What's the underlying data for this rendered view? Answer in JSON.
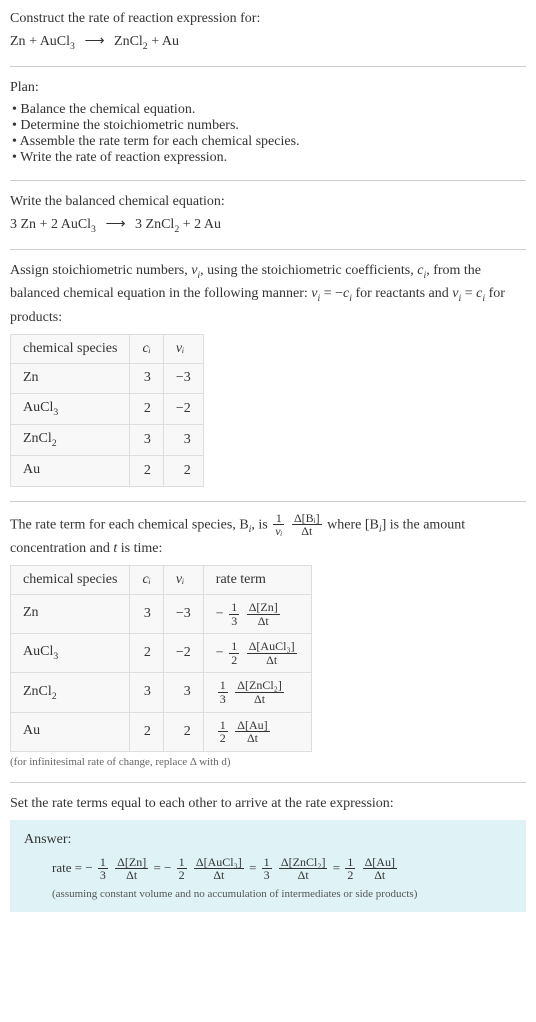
{
  "header": {
    "title": "Construct the rate of reaction expression for:",
    "reaction_lhs1": "Zn",
    "reaction_lhs2": "AuCl",
    "reaction_lhs2_sub": "3",
    "arrow": "⟶",
    "reaction_rhs1": "ZnCl",
    "reaction_rhs1_sub": "2",
    "reaction_rhs2": "Au"
  },
  "plan": {
    "title": "Plan:",
    "items": [
      "Balance the chemical equation.",
      "Determine the stoichiometric numbers.",
      "Assemble the rate term for each chemical species.",
      "Write the rate of reaction expression."
    ]
  },
  "balanced": {
    "title": "Write the balanced chemical equation:",
    "c1": "3",
    "s1": "Zn",
    "c2": "2",
    "s2": "AuCl",
    "s2sub": "3",
    "arrow": "⟶",
    "c3": "3",
    "s3": "ZnCl",
    "s3sub": "2",
    "c4": "2",
    "s4": "Au"
  },
  "stoich": {
    "para1a": "Assign stoichiometric numbers, ",
    "nu_i": "ν",
    "isub": "i",
    "para1b": ", using the stoichiometric coefficients, ",
    "c_i": "c",
    "para1c": ", from the balanced chemical equation in the following manner: ",
    "rel_react": " = −",
    "for_react": " for reactants and ",
    "rel_prod": " = ",
    "for_prod": " for products:",
    "th1": "chemical species",
    "th2": "cᵢ",
    "th3": "νᵢ",
    "rows": [
      {
        "name": "Zn",
        "sub": "",
        "c": "3",
        "nu": "−3"
      },
      {
        "name": "AuCl",
        "sub": "3",
        "c": "2",
        "nu": "−2"
      },
      {
        "name": "ZnCl",
        "sub": "2",
        "c": "3",
        "nu": "3"
      },
      {
        "name": "Au",
        "sub": "",
        "c": "2",
        "nu": "2"
      }
    ]
  },
  "rateterm": {
    "para_a": "The rate term for each chemical species, B",
    "para_b": ", is ",
    "one": "1",
    "nu_i": "νᵢ",
    "dB": "Δ[Bᵢ]",
    "dt": "Δt",
    "para_c": " where [B",
    "para_d": "] is the amount concentration and ",
    "t": "t",
    "para_e": " is time:",
    "th1": "chemical species",
    "th2": "cᵢ",
    "th3": "νᵢ",
    "th4": "rate term",
    "rows": [
      {
        "name": "Zn",
        "sub": "",
        "c": "3",
        "nu": "−3",
        "sign": "− ",
        "fn": "1",
        "fd": "3",
        "dn": "Δ[Zn]",
        "dd": "Δt"
      },
      {
        "name": "AuCl",
        "sub": "3",
        "c": "2",
        "nu": "−2",
        "sign": "− ",
        "fn": "1",
        "fd": "2",
        "dn": "Δ[AuCl₃]",
        "dd": "Δt"
      },
      {
        "name": "ZnCl",
        "sub": "2",
        "c": "3",
        "nu": "3",
        "sign": "",
        "fn": "1",
        "fd": "3",
        "dn": "Δ[ZnCl₂]",
        "dd": "Δt"
      },
      {
        "name": "Au",
        "sub": "",
        "c": "2",
        "nu": "2",
        "sign": "",
        "fn": "1",
        "fd": "2",
        "dn": "Δ[Au]",
        "dd": "Δt"
      }
    ],
    "note": "(for infinitesimal rate of change, replace Δ with d)"
  },
  "final": {
    "title": "Set the rate terms equal to each other to arrive at the rate expression:",
    "answer_label": "Answer:",
    "rate": "rate",
    "eq": " = ",
    "terms": [
      {
        "sign": "− ",
        "fn": "1",
        "fd": "3",
        "dn": "Δ[Zn]",
        "dd": "Δt"
      },
      {
        "sign": "− ",
        "fn": "1",
        "fd": "2",
        "dn": "Δ[AuCl₃]",
        "dd": "Δt"
      },
      {
        "sign": "",
        "fn": "1",
        "fd": "3",
        "dn": "Δ[ZnCl₂]",
        "dd": "Δt"
      },
      {
        "sign": "",
        "fn": "1",
        "fd": "2",
        "dn": "Δ[Au]",
        "dd": "Δt"
      }
    ],
    "assume": "(assuming constant volume and no accumulation of intermediates or side products)"
  },
  "chart_data": {
    "type": "table",
    "tables": [
      {
        "title": "stoichiometric numbers",
        "columns": [
          "chemical species",
          "c_i",
          "nu_i"
        ],
        "rows": [
          [
            "Zn",
            3,
            -3
          ],
          [
            "AuCl3",
            2,
            -2
          ],
          [
            "ZnCl2",
            3,
            3
          ],
          [
            "Au",
            2,
            2
          ]
        ]
      },
      {
        "title": "rate terms",
        "columns": [
          "chemical species",
          "c_i",
          "nu_i",
          "rate term"
        ],
        "rows": [
          [
            "Zn",
            3,
            -3,
            "-(1/3) d[Zn]/dt"
          ],
          [
            "AuCl3",
            2,
            -2,
            "-(1/2) d[AuCl3]/dt"
          ],
          [
            "ZnCl2",
            3,
            3,
            "(1/3) d[ZnCl2]/dt"
          ],
          [
            "Au",
            2,
            2,
            "(1/2) d[Au]/dt"
          ]
        ]
      }
    ]
  }
}
